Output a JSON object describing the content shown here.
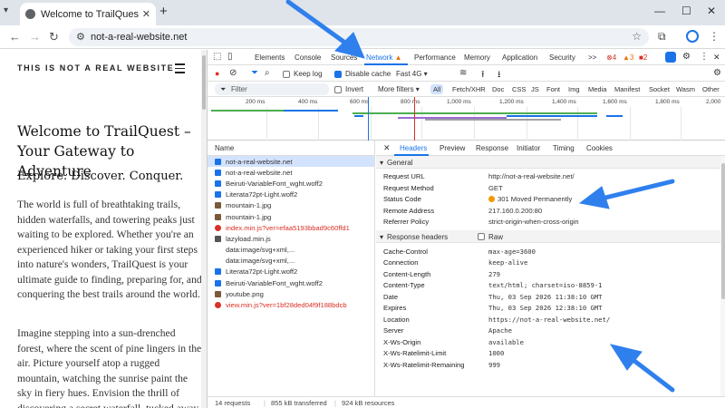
{
  "browser": {
    "tab_title": "Welcome to TrailQuest – Your G",
    "url": "not-a-real-website.net"
  },
  "page": {
    "site_name": "THIS IS NOT A REAL WEBSITE",
    "heading": "Welcome to TrailQuest – Your Gateway to Adventure",
    "subheading": "Explore. Discover. Conquer.",
    "para1": "The world is full of breathtaking trails, hidden waterfalls, and towering peaks just waiting to be explored. Whether you're an experienced hiker or taking your first steps into nature's wonders, TrailQuest is your ultimate guide to finding, preparing for, and conquering the best trails around the world.",
    "para2": "Imagine stepping into a sun-drenched forest, where the scent of pine lingers in the air. Picture yourself atop a rugged mountain, watching the sunrise paint the sky in fiery hues. Envision the thrill of discovering a secret waterfall, tucked away"
  },
  "devtools": {
    "tabs": [
      "Elements",
      "Console",
      "Sources",
      "Network",
      "Performance",
      "Memory",
      "Application",
      "Security"
    ],
    "more_tabs": ">>",
    "badges": {
      "errors": "4",
      "warnings": "3",
      "issues": "2"
    },
    "toolbar": {
      "keep_log": "Keep log",
      "disable_cache": "Disable cache",
      "throttle": "Fast 4G"
    },
    "filter_placeholder": "Filter",
    "invert": "Invert",
    "more_filters": "More filters",
    "types": [
      "All",
      "Fetch/XHR",
      "Doc",
      "CSS",
      "JS",
      "Font",
      "Img",
      "Media",
      "Manifest",
      "Socket",
      "Wasm",
      "Other"
    ],
    "ticks": [
      "200 ms",
      "400 ms",
      "600 ms",
      "800 ms",
      "1,000 ms",
      "1,200 ms",
      "1,400 ms",
      "1,600 ms",
      "1,800 ms",
      "2,000"
    ],
    "name_header": "Name",
    "requests": [
      {
        "name": "not-a-real-website.net",
        "kind": "doc",
        "selected": true
      },
      {
        "name": "not-a-real-website.net",
        "kind": "doc"
      },
      {
        "name": "Beiruti-VariableFont_wght.woff2",
        "kind": "font"
      },
      {
        "name": "Literata72pt-Light.woff2",
        "kind": "font"
      },
      {
        "name": "mountain-1.jpg",
        "kind": "img"
      },
      {
        "name": "mountain-1.jpg",
        "kind": "img"
      },
      {
        "name": "index.min.js?ver=efaa5193bbad9c60ffd1",
        "kind": "error"
      },
      {
        "name": "lazyload.min.js",
        "kind": "script"
      },
      {
        "name": "data:image/svg+xml,...",
        "kind": "data"
      },
      {
        "name": "data:image/svg+xml,...",
        "kind": "data"
      },
      {
        "name": "Literata72pt-Light.woff2",
        "kind": "font"
      },
      {
        "name": "Beiruti-VariableFont_wght.woff2",
        "kind": "font"
      },
      {
        "name": "youtube.png",
        "kind": "img"
      },
      {
        "name": "view.min.js?ver=1bf28ded04f9f188bdcb",
        "kind": "error"
      }
    ],
    "status": {
      "requests": "14 requests",
      "transferred": "855 kB transferred",
      "resources": "924 kB resources"
    },
    "detail_tabs": [
      "Headers",
      "Preview",
      "Response",
      "Initiator",
      "Timing",
      "Cookies"
    ],
    "general_title": "General",
    "general": [
      {
        "k": "Request URL",
        "v": "http://not-a-real-website.net/"
      },
      {
        "k": "Request Method",
        "v": "GET"
      },
      {
        "k": "Status Code",
        "v": "301 Moved Permanently"
      },
      {
        "k": "Remote Address",
        "v": "217.160.0.200:80"
      },
      {
        "k": "Referrer Policy",
        "v": "strict-origin-when-cross-origin"
      }
    ],
    "response_title": "Response headers",
    "raw": "Raw",
    "response": [
      {
        "k": "Cache-Control",
        "v": "max-age=3600"
      },
      {
        "k": "Connection",
        "v": "keep-alive"
      },
      {
        "k": "Content-Length",
        "v": "279"
      },
      {
        "k": "Content-Type",
        "v": "text/html; charset=iso-8859-1"
      },
      {
        "k": "Date",
        "v": "Thu, 03 Sep 2026 11:38:10 GMT"
      },
      {
        "k": "Expires",
        "v": "Thu, 03 Sep 2026 12:38:10 GMT"
      },
      {
        "k": "Location",
        "v": "https://not-a-real-website.net/"
      },
      {
        "k": "Server",
        "v": "Apache"
      },
      {
        "k": "X-Ws-Origin",
        "v": "available"
      },
      {
        "k": "X-Ws-Ratelimit-Limit",
        "v": "1000"
      },
      {
        "k": "X-Ws-Ratelimit-Remaining",
        "v": "999"
      }
    ]
  },
  "colors": {
    "accent": "#1a73e8",
    "error": "#d93025",
    "warning": "#e8710a",
    "status_dot": "#f29900"
  }
}
